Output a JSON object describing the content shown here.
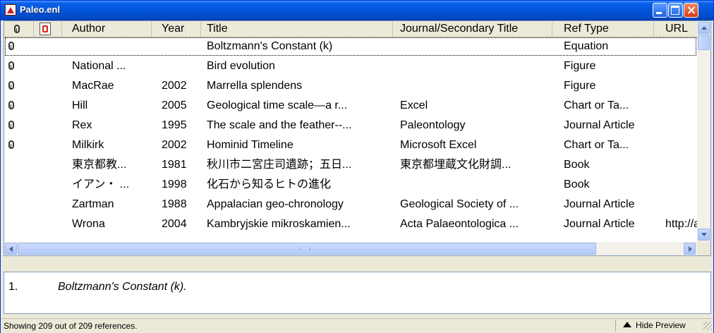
{
  "window": {
    "title": "Paleo.enl"
  },
  "columns": [
    {
      "key": "attachment",
      "label": "",
      "icon": "paperclip-icon"
    },
    {
      "key": "pdf",
      "label": "",
      "icon": "pdf-icon"
    },
    {
      "key": "author",
      "label": "Author"
    },
    {
      "key": "year",
      "label": "Year"
    },
    {
      "key": "title",
      "label": "Title"
    },
    {
      "key": "journal",
      "label": "Journal/Secondary Title"
    },
    {
      "key": "reftype",
      "label": "Ref Type"
    },
    {
      "key": "url",
      "label": "URL"
    }
  ],
  "rows": [
    {
      "attachment": true,
      "author": "",
      "year": "",
      "title": "Boltzmann's Constant (k)",
      "journal": "",
      "reftype": "Equation",
      "url": "",
      "selected": true
    },
    {
      "attachment": true,
      "author": "National ...",
      "year": "",
      "title": "Bird evolution",
      "journal": "",
      "reftype": "Figure",
      "url": ""
    },
    {
      "attachment": true,
      "author": "MacRae",
      "year": "2002",
      "title": "Marrella splendens",
      "journal": "",
      "reftype": "Figure",
      "url": ""
    },
    {
      "attachment": true,
      "author": "Hill",
      "year": "2005",
      "title": "Geological time scale—a r...",
      "journal": "Excel",
      "reftype": "Chart or Ta...",
      "url": ""
    },
    {
      "attachment": true,
      "author": "Rex",
      "year": "1995",
      "title": "The scale and the feather--...",
      "journal": "Paleontology",
      "reftype": "Journal Article",
      "url": ""
    },
    {
      "attachment": true,
      "author": "Milkirk",
      "year": "2002",
      "title": "Hominid Timeline",
      "journal": "Microsoft Excel",
      "reftype": "Chart or Ta...",
      "url": ""
    },
    {
      "attachment": false,
      "author": "東京都教...",
      "year": "1981",
      "title": "秋川市二宮庄司遺跡；五日...",
      "journal": "東京都埋蔵文化財調...",
      "reftype": "Book",
      "url": ""
    },
    {
      "attachment": false,
      "author": "イアン・ ...",
      "year": "1998",
      "title": "化石から知るヒトの進化",
      "journal": "",
      "reftype": "Book",
      "url": ""
    },
    {
      "attachment": false,
      "author": "Zartman",
      "year": "1988",
      "title": "Appalacian geo-chronology",
      "journal": "Geological Society of ...",
      "reftype": "Journal Article",
      "url": ""
    },
    {
      "attachment": false,
      "author": "Wrona",
      "year": "2004",
      "title": "Kambryjskie mikroskamien...",
      "journal": "Acta Palaeontologica ...",
      "reftype": "Journal Article",
      "url": "http://a"
    }
  ],
  "preview": {
    "number": "1.",
    "text": "Boltzmann's Constant (k)."
  },
  "status": {
    "text": "Showing 209 out of 209 references.",
    "hide_preview_label": "Hide Preview"
  },
  "colors": {
    "titlebar": "#0356d8",
    "selection_outline": "#000000",
    "scrollbar": "#b4cbfa"
  }
}
